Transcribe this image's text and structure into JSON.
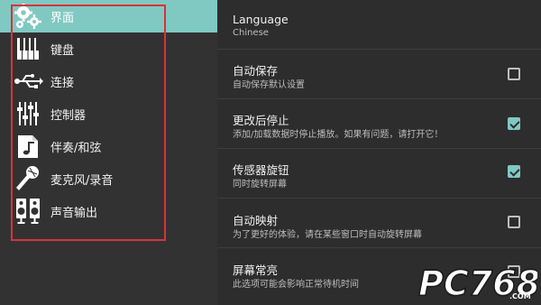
{
  "sidebar": {
    "items": [
      {
        "label": "界面",
        "icon": "gears-icon",
        "active": true
      },
      {
        "label": "键盘",
        "icon": "keyboard-icon",
        "active": false
      },
      {
        "label": "连接",
        "icon": "usb-icon",
        "active": false
      },
      {
        "label": "控制器",
        "icon": "sliders-icon",
        "active": false
      },
      {
        "label": "伴奏/和弦",
        "icon": "music-note-icon",
        "active": false
      },
      {
        "label": "麦克风/录音",
        "icon": "microphone-icon",
        "active": false
      },
      {
        "label": "声音输出",
        "icon": "speakers-icon",
        "active": false
      }
    ],
    "highlight_color": "#d8333a",
    "accent_color": "#7fc9c2"
  },
  "settings": [
    {
      "title": "Language",
      "summary": "Chinese",
      "has_checkbox": false
    },
    {
      "title": "自动保存",
      "summary": "自动保存默认设置",
      "has_checkbox": true,
      "checked": false
    },
    {
      "title": "更改后停止",
      "summary": "添加/加载数据时停止播放。如果有问题，请打开它！",
      "has_checkbox": true,
      "checked": true
    },
    {
      "title": "传感器旋钮",
      "summary": "同时旋转屏幕",
      "has_checkbox": true,
      "checked": true
    },
    {
      "title": "自动映射",
      "summary": "为了更好的体验，请在某些窗口时自动旋转屏幕",
      "has_checkbox": true,
      "checked": false
    },
    {
      "title": "屏幕常亮",
      "summary": "此选项可能会影响正常待机时间",
      "has_checkbox": true,
      "checked": false
    }
  ],
  "watermark": {
    "text": "PC768",
    "suffix": ".COM"
  }
}
